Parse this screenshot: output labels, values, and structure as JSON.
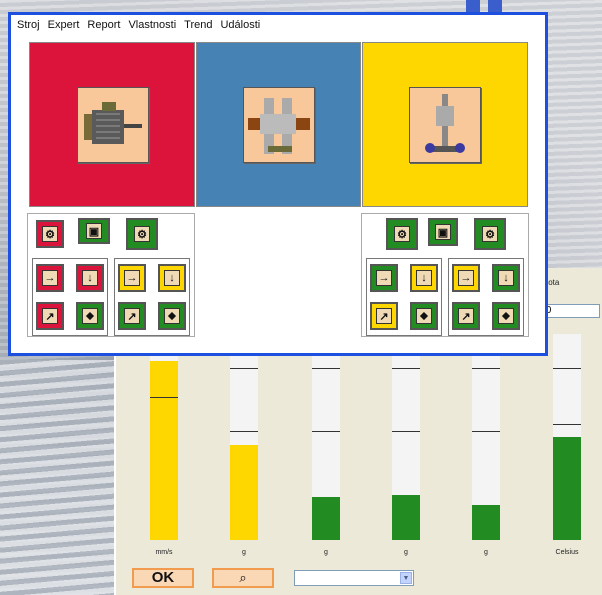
{
  "menu": [
    "Stroj",
    "Expert",
    "Report",
    "Vlastnosti",
    "Trend",
    "Události"
  ],
  "back_panel": {
    "header": "plota",
    "value": ".0",
    "units": [
      "mm/s",
      "g",
      "g",
      "g",
      "g",
      "Celsius"
    ],
    "ok_label": "OK",
    "lens_label": "⌕",
    "gauges": [
      {
        "color": "#ffd700",
        "level": 0.87
      },
      {
        "color": "#ffd700",
        "level": 0.46
      },
      {
        "color": "#228b22",
        "level": 0.21
      },
      {
        "color": "#228b22",
        "level": 0.22
      },
      {
        "color": "#228b22",
        "level": 0.17
      },
      {
        "color": "#228b22",
        "level": 0.5
      }
    ]
  },
  "colors": {
    "red": "#dc143c",
    "blue": "#4682b4",
    "yellow": "#ffd700",
    "green": "#228b22",
    "window_border": "#1e50e0"
  }
}
